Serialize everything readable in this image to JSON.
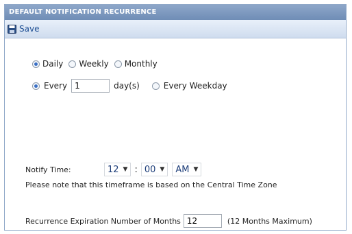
{
  "panel": {
    "title": "DEFAULT NOTIFICATION RECURRENCE",
    "save_label": "Save",
    "save_icon": "floppy-disk-icon"
  },
  "frequency": {
    "options": [
      "Daily",
      "Weekly",
      "Monthly"
    ],
    "selected": "Daily"
  },
  "interval": {
    "every_label": "Every",
    "every_value": "1",
    "unit_label": "day(s)",
    "weekday_label": "Every Weekday",
    "selected": "Every"
  },
  "notify": {
    "label": "Notify Time:",
    "hour": "12",
    "separator": ":",
    "minute": "00",
    "ampm": "AM",
    "note": "Please note that this timeframe is based on the Central Time Zone"
  },
  "expiration": {
    "label": "Recurrence Expiration Number of Months",
    "value": "12",
    "max_note": "(12 Months Maximum)"
  }
}
